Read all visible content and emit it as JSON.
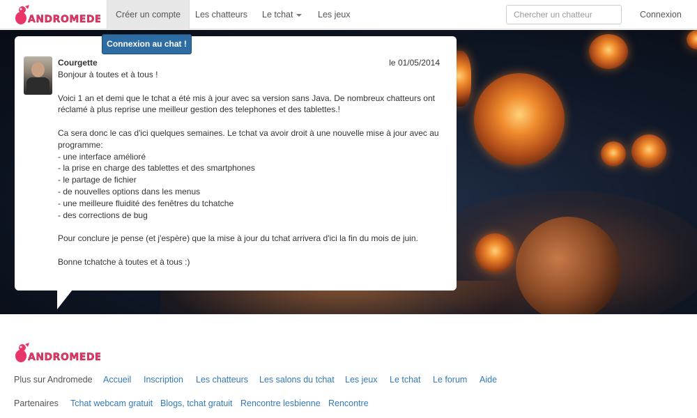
{
  "brand": {
    "name": "Andromede",
    "logo_text": "ANDROMEDE",
    "logo_color": "#e8356a"
  },
  "nav": {
    "items": [
      {
        "label": "Créer un compte",
        "active": true
      },
      {
        "label": "Les chatteurs",
        "active": false
      },
      {
        "label": "Le tchat",
        "active": false,
        "dropdown": true
      },
      {
        "label": "Les jeux",
        "active": false
      }
    ],
    "search_placeholder": "Chercher un chatteur",
    "login_label": "Connexion"
  },
  "chat_button_label": "Connexion au chat !",
  "message": {
    "author": "Courgette",
    "date": "le 01/05/2014",
    "paragraphs": [
      "Bonjour à toutes et à tous !",
      "Voici 1 an et demi que le tchat a été mis à jour avec sa version sans Java. De nombreux chatteurs ont réclamé à plus reprise une meilleur gestion des telephones et des tablettes.!",
      "Ca sera donc le cas d'ici quelques semaines. Le tchat va avoir droit à une nouvelle mise à jour avec au programme:\n- une interface amélioré\n- la prise en charge des tablettes et des smartphones\n- le partage de fichier\n- de nouvelles options dans les menus\n- une meilleure fluidité des fenêtres du tchatche\n- des corrections de bug",
      "Pour conclure je pense (et j'espère) que la mise à jour du tchat arrivera d'ici la fin du mois de juin.",
      "Bonne tchatche à toutes et à tous :)"
    ]
  },
  "footer": {
    "more_label": "Plus sur Andromede",
    "more_links": [
      "Accueil",
      "Inscription",
      "Les chatteurs",
      "Les salons du tchat",
      "Les jeux",
      "Le tchat",
      "Le forum",
      "Aide"
    ],
    "partners_label": "Partenaires",
    "partner_links": [
      "Tchat webcam gratuit",
      "Blogs, tchat gratuit",
      "Rencontre lesbienne",
      "Rencontre"
    ]
  },
  "colors": {
    "link": "#337ab7",
    "button": "#2e6da4",
    "accent": "#e8356a"
  }
}
